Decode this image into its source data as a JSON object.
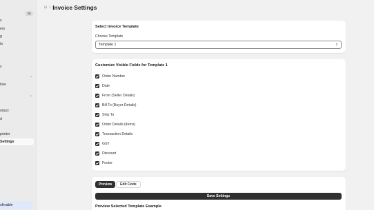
{
  "sidebar": {
    "badge": "28",
    "items": [
      {
        "label": "s"
      },
      {
        "label": "ers"
      },
      {
        "label": "g"
      },
      {
        "label": "ts"
      },
      {
        "label": "s"
      },
      {
        "label": "tore"
      },
      {
        "label": "oduct"
      },
      {
        "label": "d"
      },
      {
        "label": "printer"
      },
      {
        "label": "Settings"
      },
      {
        "label": "sferable"
      }
    ],
    "chevron": "›"
  },
  "header": {
    "breadcrumb_icon": "⊟",
    "separator": "›",
    "title": "Invoice Settings"
  },
  "select_template": {
    "title": "Select Invoice Template",
    "label": "Choose Template",
    "value": "Template 1",
    "chevron": "⇕"
  },
  "fields": {
    "title": "Customize Visible Fields for Template 1",
    "items": [
      "Order Number",
      "Date",
      "From (Seller Details)",
      "Bill To (Buyer Details)",
      "Ship To",
      "Order Details (Items)",
      "Transaction Details",
      "GST",
      "Discount",
      "Footer"
    ]
  },
  "actions": {
    "preview_tab": "Preview",
    "edit_tab": "Edit Code",
    "save_label": "Save Settings",
    "preview_title": "Preview Selected Template Example"
  }
}
